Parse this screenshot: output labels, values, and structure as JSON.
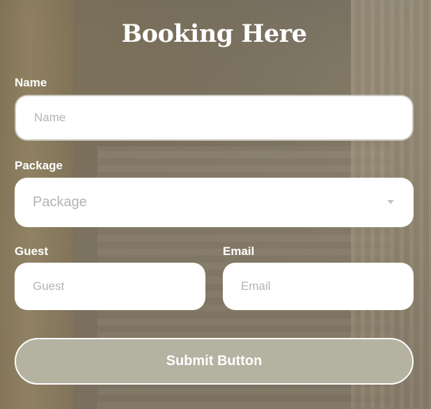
{
  "form": {
    "title": "Booking Here",
    "name": {
      "label": "Name",
      "placeholder": "Name",
      "value": ""
    },
    "package": {
      "label": "Package",
      "selected": "Package"
    },
    "guest": {
      "label": "Guest",
      "placeholder": "Guest",
      "value": ""
    },
    "email": {
      "label": "Email",
      "placeholder": "Email",
      "value": ""
    },
    "submit_label": "Submit Button"
  },
  "icons": {
    "package_dropdown": "chevron-down-icon"
  },
  "colors": {
    "submit_background": "#b4b2a1",
    "field_background": "#ffffff",
    "placeholder": "#b3b3b3",
    "label_text": "#ffffff"
  }
}
